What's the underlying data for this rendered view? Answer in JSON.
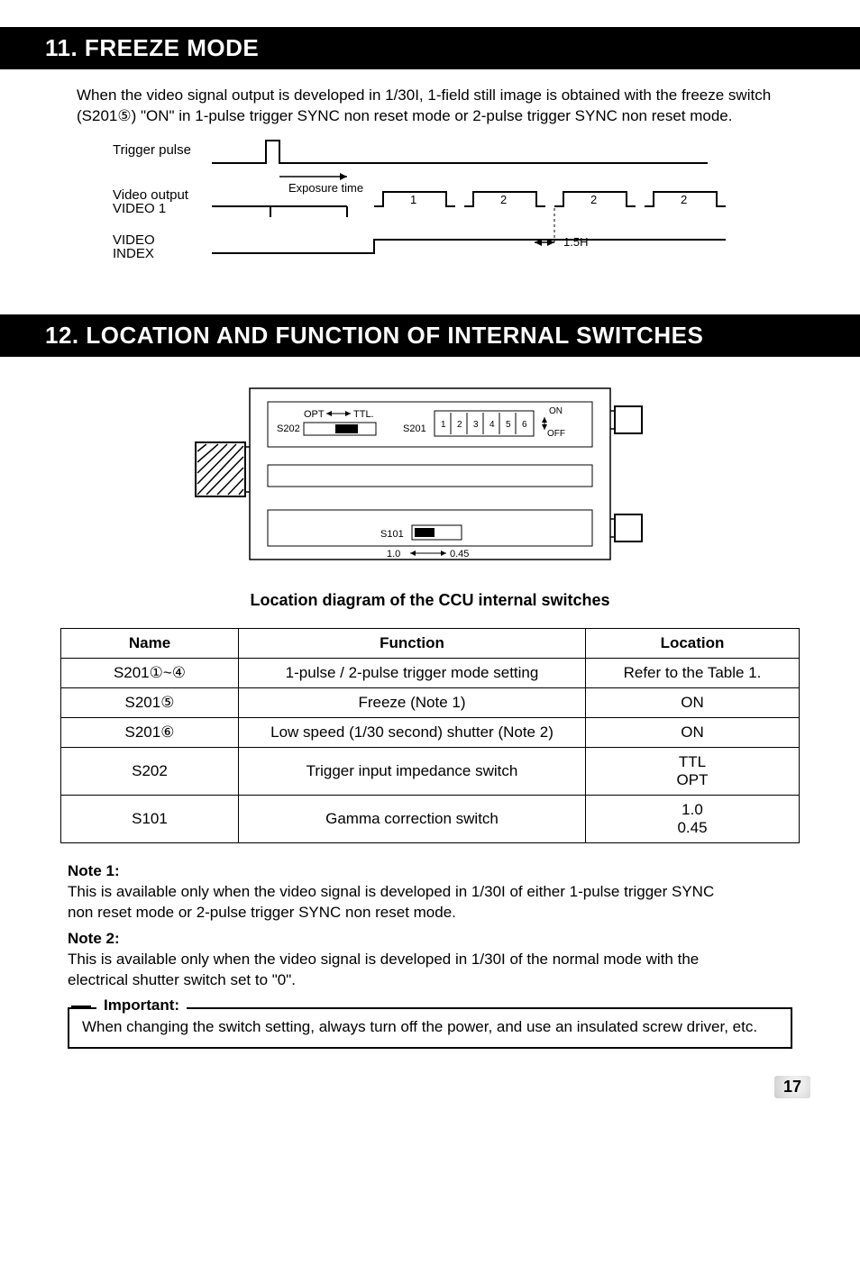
{
  "section11": {
    "title": "11. FREEZE MODE",
    "para": "When the video signal output is developed in 1/30I, 1-field still image is obtained with the freeze switch (S201⑤) \"ON\" in 1-pulse trigger SYNC non reset mode or 2-pulse trigger SYNC non reset mode.",
    "labels": {
      "trigger": "Trigger pulse",
      "video": "Video output",
      "video1": "VIDEO 1",
      "vindex": "VIDEO INDEX",
      "exposure": "Exposure time",
      "h15": "1.5H",
      "f1": "1",
      "f2a": "2",
      "f2b": "2",
      "f2c": "2"
    }
  },
  "section12": {
    "title": "12. LOCATION AND FUNCTION OF INTERNAL SWITCHES",
    "diagram": {
      "opt": "OPT",
      "ttl": "TTL.",
      "s202": "S202",
      "s201": "S201",
      "s101": "S101",
      "on": "ON",
      "off": "OFF",
      "dips": [
        "1",
        "2",
        "3",
        "4",
        "5",
        "6"
      ],
      "g10": "1.0",
      "g045": "0.45"
    },
    "caption": "Location diagram of the CCU internal switches",
    "table": {
      "head": {
        "name": "Name",
        "func": "Function",
        "loc": "Location"
      },
      "rows": [
        {
          "name": "S201①~④",
          "func": "1-pulse / 2-pulse trigger mode setting",
          "loc": "Refer to the Table 1."
        },
        {
          "name": "S201⑤",
          "func": "Freeze (Note 1)",
          "loc": "ON"
        },
        {
          "name": "S201⑥",
          "func": "Low speed (1/30 second) shutter (Note 2)",
          "loc": "ON"
        },
        {
          "name": "S202",
          "func": "Trigger input impedance switch",
          "loc": "TTL\nOPT"
        },
        {
          "name": "S101",
          "func": "Gamma correction switch",
          "loc": "1.0\n0.45"
        }
      ]
    },
    "notes": {
      "n1tag": "Note 1:",
      "n1": "This is available only when the video signal is developed in 1/30I of either 1-pulse trigger SYNC non reset mode or 2-pulse trigger SYNC non reset mode.",
      "n2tag": "Note 2:",
      "n2": "This is available only when the video signal is developed in 1/30I of the normal mode with the electrical shutter switch set to \"0\"."
    },
    "important": {
      "label": "Important:",
      "text": "When changing the switch setting, always turn off the power, and use an insulated screw driver, etc."
    }
  },
  "page_number": "17"
}
